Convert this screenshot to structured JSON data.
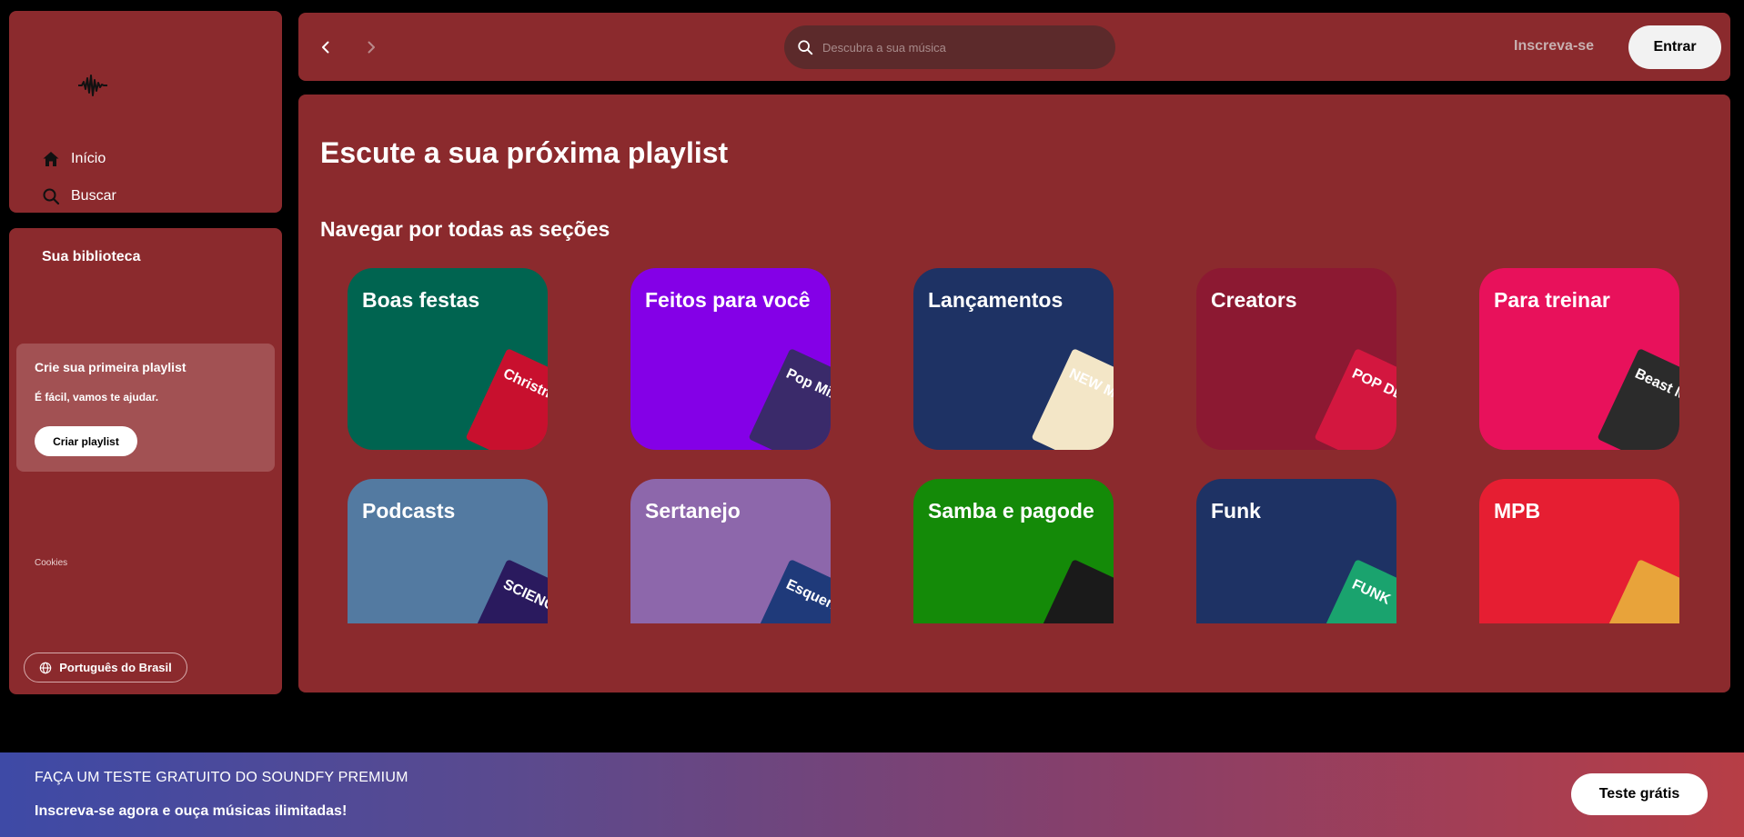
{
  "sidebar": {
    "logo_icon": "soundwave-icon",
    "nav": [
      {
        "label": "Início",
        "icon": "home-icon"
      },
      {
        "label": "Buscar",
        "icon": "search-icon"
      }
    ],
    "library": {
      "title": "Sua biblioteca",
      "create_card": {
        "title": "Crie sua primeira playlist",
        "subtitle": "É fácil, vamos te ajudar.",
        "button": "Criar playlist"
      },
      "cookies": "Cookies",
      "language": "Português do Brasil"
    }
  },
  "topbar": {
    "search_placeholder": "Descubra a sua música",
    "signup": "Inscreva-se",
    "login": "Entrar"
  },
  "main": {
    "title": "Escute a sua próxima playlist",
    "section_title": "Navegar por todas as seções",
    "categories": [
      {
        "label": "Boas festas",
        "color": "#006450",
        "art_text": "Christmas Hits",
        "art_color": "#c8102e"
      },
      {
        "label": "Feitos para você",
        "color": "#8400e7",
        "art_text": "Pop Mix",
        "art_color": "#3a2a6a"
      },
      {
        "label": "Lançamentos",
        "color": "#1e3264",
        "art_text": "NEW MUSIC FRIDAY",
        "art_color": "#f3e6c7"
      },
      {
        "label": "Creators",
        "color": "#8c1932",
        "art_text": "POP DELAS",
        "art_color": "#d3173f"
      },
      {
        "label": "Para treinar",
        "color": "#e8115b",
        "art_text": "Beast Mode",
        "art_color": "#2b2b2b"
      },
      {
        "label": "Podcasts",
        "color": "#537aa1",
        "art_text": "SCIENCE VS",
        "art_color": "#2a1a5e"
      },
      {
        "label": "Sertanejo",
        "color": "#8d67ab",
        "art_text": "Esquenta Sertanejo",
        "art_color": "#1f3a7a"
      },
      {
        "label": "Samba e pagode",
        "color": "#148a08",
        "art_text": "",
        "art_color": "#1a1a1a"
      },
      {
        "label": "Funk",
        "color": "#1e3264",
        "art_text": "FUNK",
        "art_color": "#1aa36e"
      },
      {
        "label": "MPB",
        "color": "#e61e32",
        "art_text": "",
        "art_color": "#e8a33a"
      }
    ]
  },
  "banner": {
    "title": "FAÇA UM TESTE GRATUITO DO SOUNDFY PREMIUM",
    "subtitle": "Inscreva-se agora e ouça músicas ilimitadas!",
    "button": "Teste grátis"
  }
}
